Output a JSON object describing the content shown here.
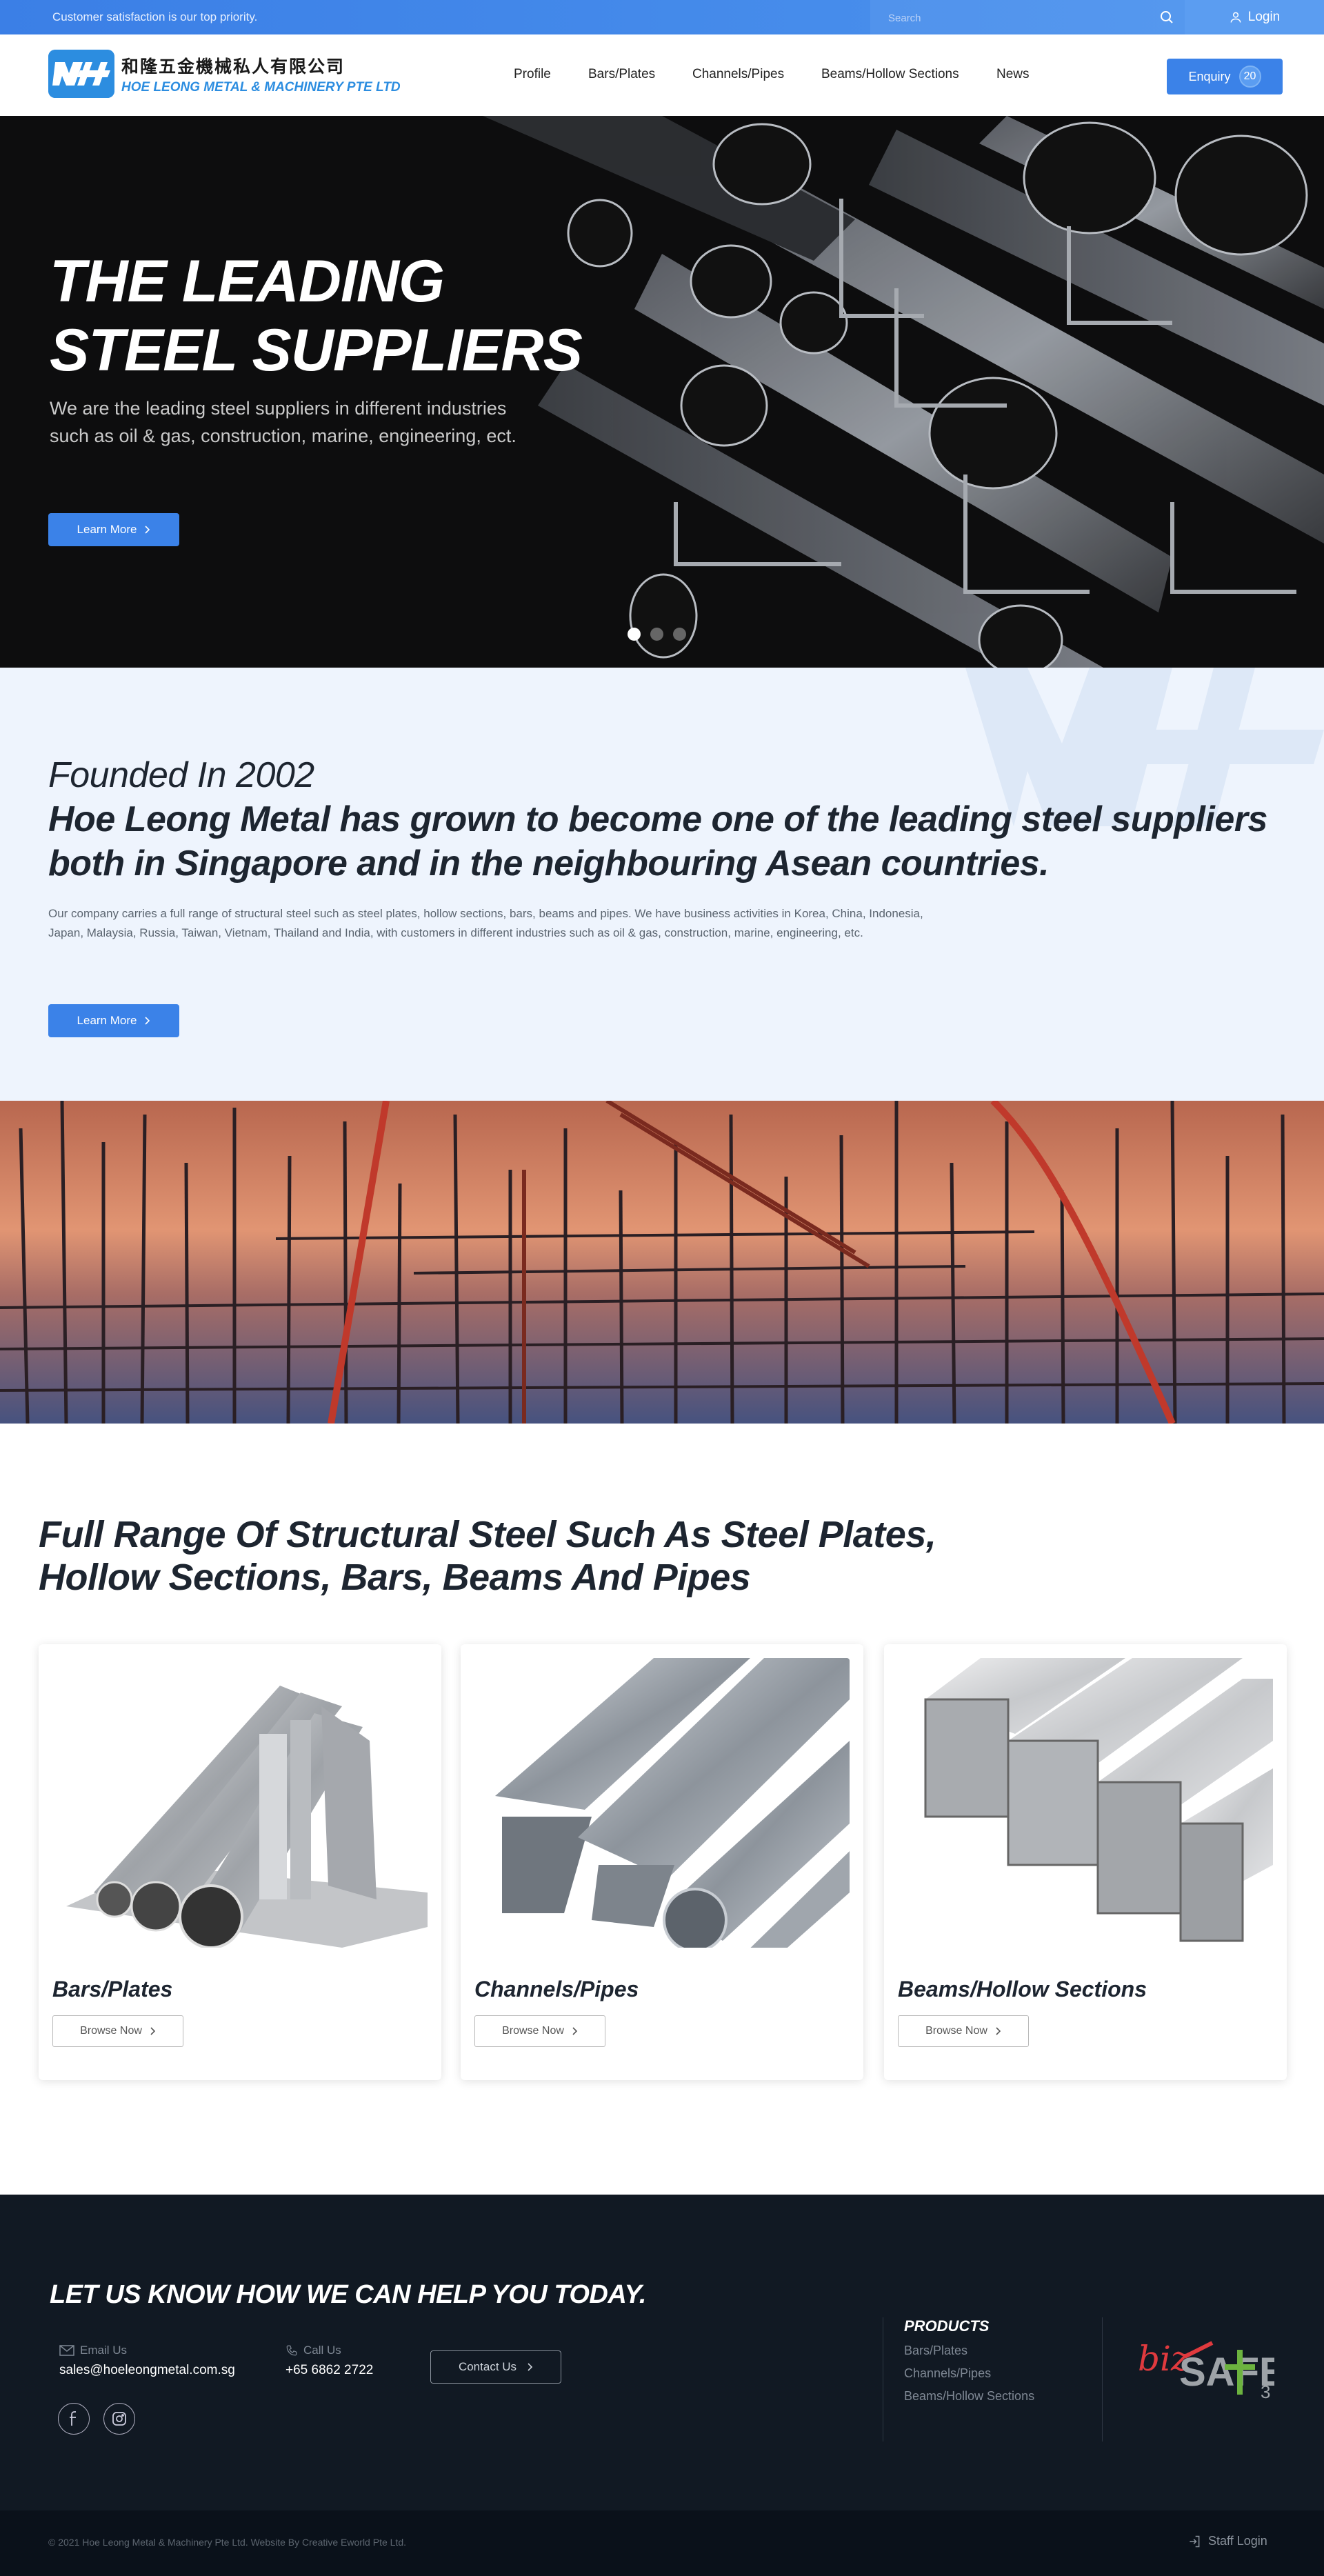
{
  "topbar": {
    "message": "Customer satisfaction is our top priority.",
    "search_placeholder": "Search",
    "login_label": "Login"
  },
  "header": {
    "logo_cn": "和隆五金機械私人有限公司",
    "logo_en": "HOE LEONG METAL & MACHINERY PTE LTD",
    "nav": [
      "Profile",
      "Bars/Plates",
      "Channels/Pipes",
      "Beams/Hollow Sections",
      "News"
    ],
    "enquiry_label": "Enquiry",
    "enquiry_count": "20"
  },
  "hero": {
    "title_line1": "THE LEADING",
    "title_line2": "STEEL SUPPLIERS",
    "subtitle": "We are the leading steel suppliers in different industries such as oil & gas, construction, marine, engineering, ect.",
    "button": "Learn More",
    "slides": 3,
    "active_slide": 1
  },
  "about": {
    "line1": "Founded In 2002",
    "line2": "Hoe Leong Metal has grown to become one of the leading steel suppliers both in Singapore and in the neighbouring Asean countries.",
    "body": "Our company carries a full range of structural steel such as steel plates, hollow sections, bars, beams and pipes. We have business activities in Korea, China, Indonesia, Japan, Malaysia, Russia, Taiwan, Vietnam, Thailand and India, with customers in different industries such as oil & gas, construction, marine, engineering, etc.",
    "button": "Learn More"
  },
  "products": {
    "heading": "Full Range Of Structural Steel Such As Steel Plates, Hollow Sections, Bars, Beams And Pipes",
    "items": [
      {
        "title": "Bars/Plates",
        "button": "Browse Now"
      },
      {
        "title": "Channels/Pipes",
        "button": "Browse Now"
      },
      {
        "title": "Beams/Hollow Sections",
        "button": "Browse Now"
      }
    ]
  },
  "footer": {
    "heading": "LET US KNOW HOW WE CAN HELP YOU TODAY.",
    "email_label": "Email Us",
    "email": "sales@hoeleongmetal.com.sg",
    "call_label": "Call Us",
    "phone": "+65 6862 2722",
    "contact_button": "Contact Us",
    "products_heading": "PRODUCTS",
    "product_links": [
      "Bars/Plates",
      "Channels/Pipes",
      "Beams/Hollow Sections"
    ],
    "bizsafe_prefix": "biz",
    "bizsafe_main": "SAFE",
    "bizsafe_level": "3",
    "copyright": "© 2021 Hoe Leong Metal & Machinery Pte Ltd. Website By Creative Eworld Pte Ltd.",
    "staff_login": "Staff Login"
  },
  "colors": {
    "accent": "#3b82e8",
    "topbar": "#4189ea",
    "footer_bg": "#111923",
    "about_bg": "#eef4fd"
  }
}
